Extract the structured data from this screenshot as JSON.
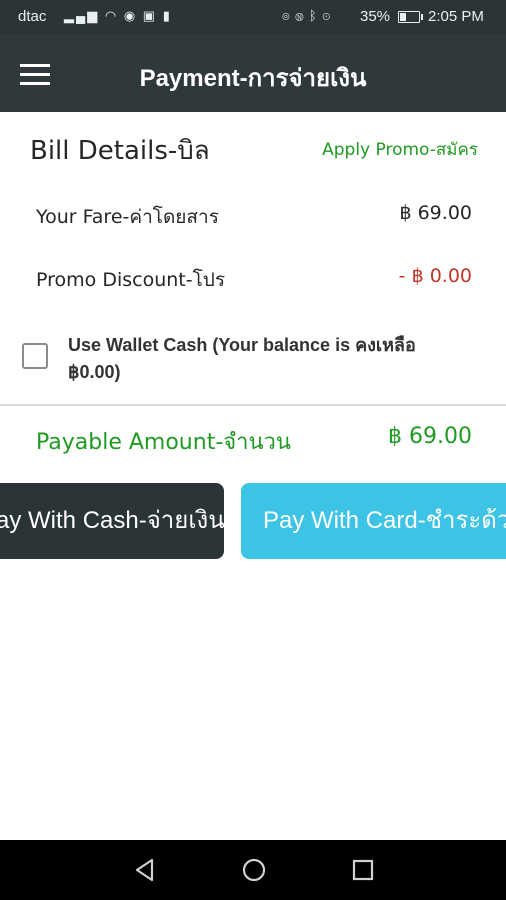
{
  "status_bar": {
    "carrier": "dtac",
    "battery": "35%",
    "time": "2:05 PM",
    "left_icons": [
      "signal-icon",
      "wifi-icon",
      "app-icon",
      "image-icon",
      "sim-icon"
    ],
    "right_icons": [
      "eye-icon",
      "nfc-icon",
      "bluetooth-icon",
      "location-icon"
    ]
  },
  "app_bar": {
    "title": "Payment-การจ่ายเงิน",
    "menu_icon": "hamburger-menu-icon"
  },
  "bill": {
    "title": "Bill Details-บิล",
    "apply_promo": "Apply Promo-สมัคร",
    "fare_label": "Your Fare-ค่าโดยสาร",
    "fare_value": "฿ 69.00",
    "discount_label": "Promo Discount-โปร",
    "discount_value": "- ฿ 0.00",
    "wallet_line1": "Use Wallet Cash (Your balance is คงเหลือ",
    "wallet_line2": "฿0.00)",
    "wallet_checked": false,
    "payable_label": "Payable Amount-จำนวน",
    "payable_value": "฿ 69.00"
  },
  "actions": {
    "cash_label": "Pay With Cash-จ่ายเงินสด",
    "card_label": "Pay With Card-ชำระด้วยบัตร"
  },
  "colors": {
    "app_bar": "#2f393b",
    "green": "#1f9a22",
    "red": "#c0392b",
    "cash_button": "#2b3436",
    "card_button": "#3cc3e6"
  },
  "nav_bar": {
    "icons": [
      "back-icon",
      "home-icon",
      "recents-icon"
    ]
  }
}
